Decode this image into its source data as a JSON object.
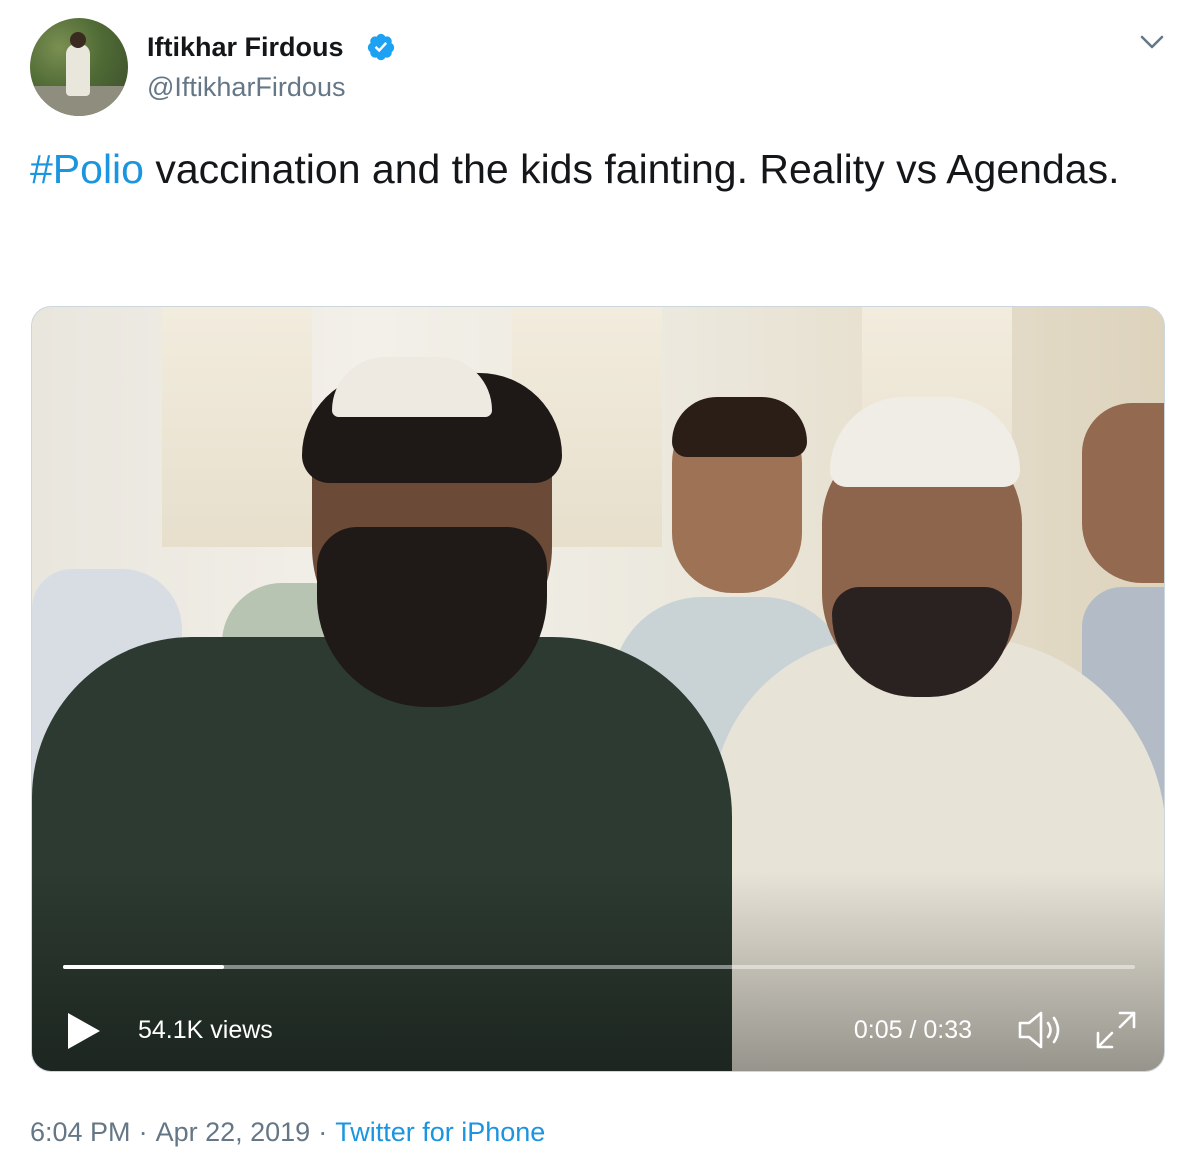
{
  "author": {
    "display_name": "Iftikhar Firdous",
    "handle": "@IftikharFirdous",
    "verified": true,
    "avatar_icon": "profile-photo"
  },
  "tweet": {
    "hashtag": "#Polio",
    "text": " vaccination and the kids fainting. Reality vs Agendas."
  },
  "video": {
    "views": "54.1K views",
    "time": "0:05 / 0:33",
    "progress_fraction": 0.15,
    "play_icon": "play-icon",
    "volume_icon": "volume-icon",
    "fullscreen_icon": "fullscreen-icon"
  },
  "footer": {
    "time": "6:04 PM",
    "separator": "·",
    "date": "Apr 22, 2019",
    "source": "Twitter for iPhone"
  },
  "colors": {
    "link": "#1b95e0",
    "secondary_text": "#657786",
    "verified_badge": "#1da1f2"
  }
}
